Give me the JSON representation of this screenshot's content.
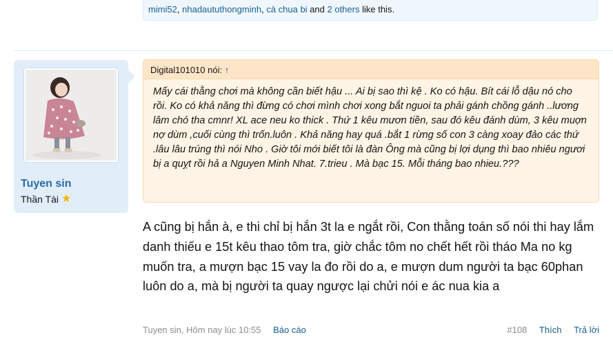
{
  "likes": {
    "users": [
      "mimi52",
      "nhadaututhongminh",
      "cà chua bi"
    ],
    "sep1": ", ",
    "sep2": ", ",
    "and": " and ",
    "others": "2 others",
    "suffix": " like this."
  },
  "user": {
    "name": "Tuyen sin",
    "title": "Thần Tài",
    "badge_icon": "star-icon"
  },
  "quote": {
    "author": "Digital101010 nói:",
    "arrow": "↑",
    "text": "Mấy cái thằng chơi mà không cần biết hậu ... Ai bị sao thì kệ . Ko có hậu. Bít cái lỗ dậu nó cho rồi. Ko có khả năng thì đừng có chơi mình chơi xong bắt nguoi ta phải gánh chồng gánh ..lương lâm chó tha cmnr! XL ace neu ko thick . Thứ 1 kêu mươn tiền, sau đó kêu đánh dùm, 3 kêu muợn nợ dùm ,cuối cùng thì trốn.luôn . Khả năng hay quá .bắt 1 rừng số con 3 càng xoay đảo các thứ .lâu lâu trúng thì nói Nho . Giờ tôi mới biết tôi là đàn Ông mà cũng bị lợi dụng thì bao nhiêu ngươi bị a quỵt rồi hả a Nguyen Minh Nhat. 7.trieu . Mà bạc 15. Mỗi tháng bao nhieu.???"
  },
  "post": {
    "text": "A cũng bị hắn à, e thi chỉ bị hắn 3t la e ngắt rồi, Con thằng toán số nói thi hay lắm danh thiếu e 15t kêu thao tôm tra, giờ chắc tôm no chết hết rồi tháo Ma no kg muốn tra, a mượn bạc 15 vay la đo rồi do a, e mượn dum người ta bạc 60phan luôn do a, mà bị người ta quay ngược lại chửi nói e ác nua kia a"
  },
  "footer": {
    "meta": "Tuyen sin, Hôm nay lúc 10:55",
    "report": "Báo cáo",
    "post_number": "#108",
    "like": "Thích",
    "reply": "Trả lời"
  },
  "colors": {
    "link": "#176093",
    "username": "#2b6aa8",
    "user_panel_bg": "#e1eefa",
    "quote_bg": "#fff4e5",
    "quote_head_bg": "#ffe5c7"
  }
}
